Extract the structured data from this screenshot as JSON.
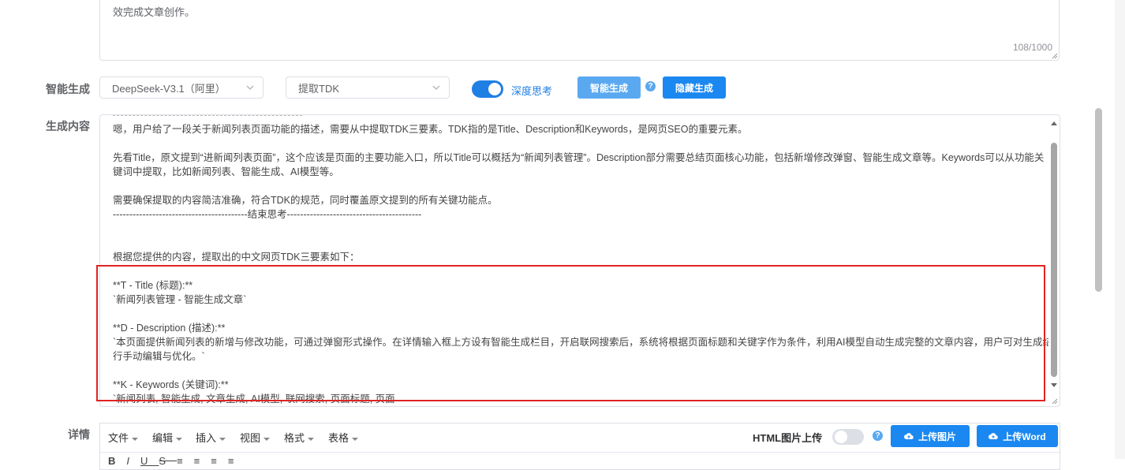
{
  "top_textarea": {
    "text": "效完成文章创作。",
    "count": "108/1000"
  },
  "smart_gen": {
    "label": "智能生成",
    "model_select": "DeepSeek-V3.1（阿里）",
    "task_select": "提取TDK",
    "deep_think_label": "深度思考",
    "deep_think_on": true,
    "generate_button": "智能生成",
    "help_icon": "?",
    "hide_button": "隐藏生成"
  },
  "content": {
    "label": "生成内容",
    "lines": [
      "嗯，用户给了一段关于新闻列表页面功能的描述，需要从中提取TDK三要素。TDK指的是Title、Description和Keywords，是网页SEO的重要元素。",
      "先看Title，原文提到“进新闻列表页面”，这个应该是页面的主要功能入口，所以Title可以概括为“新闻列表管理”。Description部分需要总结页面核心功能，包括新增修改弹窗、智能生成文章等。Keywords可以从功能关",
      "键词中提取，比如新闻列表、智能生成、AI模型等。",
      "需要确保提取的内容简洁准确，符合TDK的规范，同时覆盖原文提到的所有关键功能点。",
      "-----------------------------------------结束思考-----------------------------------------",
      "根据您提供的内容，提取出的中文网页TDK三要素如下：",
      "**T - Title (标题):**",
      "`新闻列表管理 - 智能生成文章`",
      "**D - Description (描述):**",
      "`本页面提供新闻列表的新增与修改功能，可通过弹窗形式操作。在详情输入框上方设有智能生成栏目，开启联网搜索后，系统将根据页面标题和关键字作为条件，利用AI模型自动生成完整的文章内容，用户可对生成结果进",
      "行手动编辑与优化。`",
      "**K - Keywords (关键词):**",
      "`新闻列表, 智能生成, 文章生成, AI模型, 联网搜索, 页面标题, 页面"
    ]
  },
  "details": {
    "label": "详情",
    "menus": [
      "文件",
      "编辑",
      "插入",
      "视图",
      "格式",
      "表格"
    ],
    "html_upload_label": "HTML图片上传",
    "html_upload_on": false,
    "upload_image": "上传图片",
    "upload_word": "上传Word"
  }
}
